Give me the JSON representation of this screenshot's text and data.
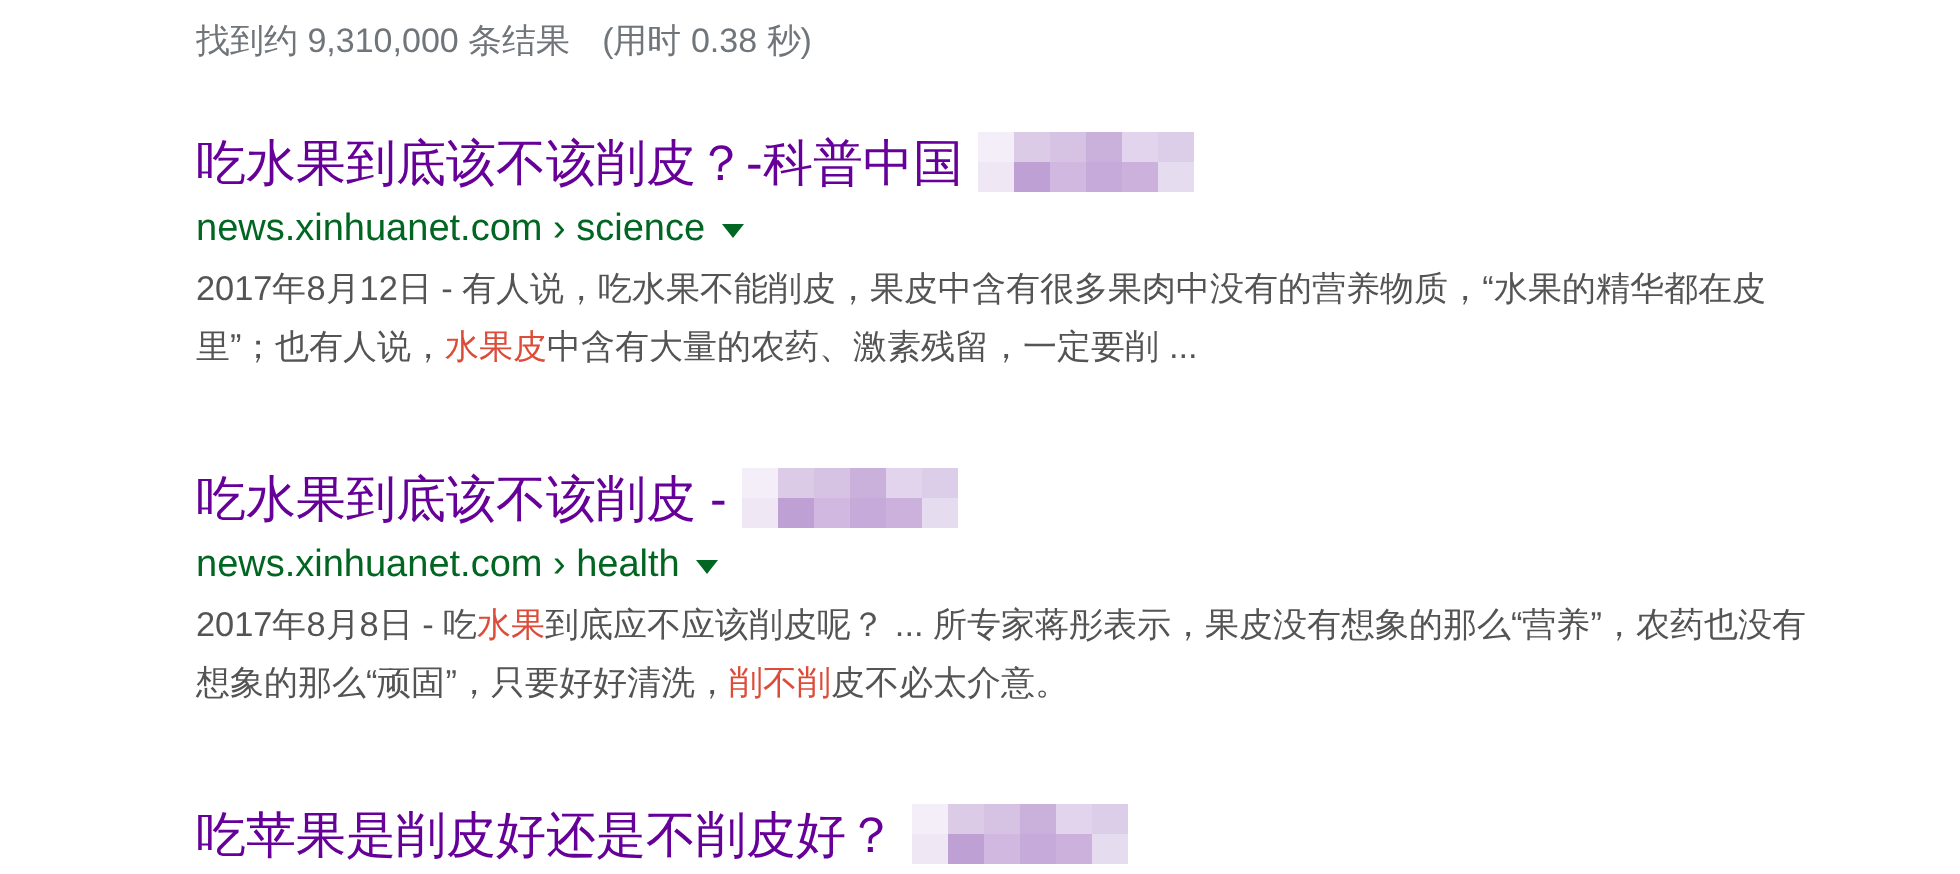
{
  "stats": {
    "count": "找到约 9,310,000 条结果",
    "time": "(用时 0.38 秒)"
  },
  "results": [
    {
      "title": "吃水果到底该不该削皮？-科普中国",
      "blurred": true,
      "url": "news.xinhuanet.com › science",
      "snippet": [
        {
          "text": "2017年8月12日 - 有人说，吃水果不能削皮，果皮中含有很多果肉中没有的营养物质，“水果的精华都在皮里”；也有人说，",
          "highlight": false
        },
        {
          "text": "水果皮",
          "highlight": true
        },
        {
          "text": "中含有大量的农药、激素残留，一定要削 ...",
          "highlight": false
        }
      ]
    },
    {
      "title": "吃水果到底该不该削皮 -",
      "blurred": true,
      "url": "news.xinhuanet.com › health",
      "snippet": [
        {
          "text": "2017年8月8日 - 吃",
          "highlight": false
        },
        {
          "text": "水果",
          "highlight": true
        },
        {
          "text": "到底应不应该削皮呢？ ... 所专家蒋彤表示，果皮没有想象的那么“营养”，农药也没有想象的那么“顽固”，只要好好清洗，",
          "highlight": false
        },
        {
          "text": "削不削",
          "highlight": true
        },
        {
          "text": "皮不必太介意。",
          "highlight": false
        }
      ]
    },
    {
      "title": "吃苹果是削皮好还是不削皮好？",
      "blurred": true
    }
  ]
}
